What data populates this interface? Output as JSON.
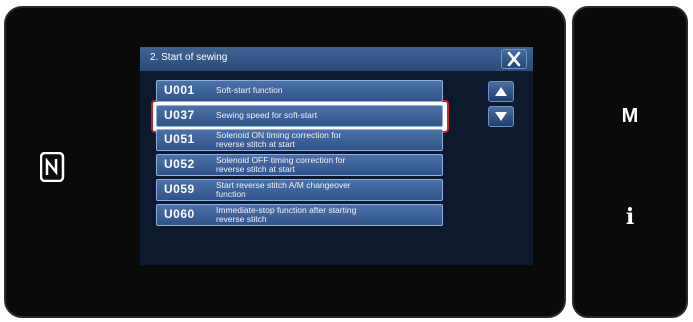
{
  "dialog": {
    "title": "2.  Start of sewing"
  },
  "items": [
    {
      "code": "U001",
      "line1": "Soft-start function",
      "line2": ""
    },
    {
      "code": "U037",
      "line1": "Sewing speed for soft-start",
      "line2": ""
    },
    {
      "code": "U051",
      "line1": "Solenoid ON timing correction for",
      "line2": "reverse stitch at start"
    },
    {
      "code": "U052",
      "line1": "Solenoid OFF timing correction for",
      "line2": "reverse stitch at start"
    },
    {
      "code": "U059",
      "line1": "Start reverse stitch A/M changeover",
      "line2": "function"
    },
    {
      "code": "U060",
      "line1": "Immediate-stop function after starting",
      "line2": "reverse stitch"
    }
  ],
  "side_buttons": {
    "mode": "M",
    "info": "i"
  },
  "colors": {
    "selection_frame": "#c8202a",
    "list_item": "#3b6196",
    "title_bar": "#2f5585"
  },
  "icons": {
    "nfc": "nfc-icon",
    "close": "close-icon",
    "scroll_up": "triangle-up-icon",
    "scroll_down": "triangle-down-icon"
  }
}
